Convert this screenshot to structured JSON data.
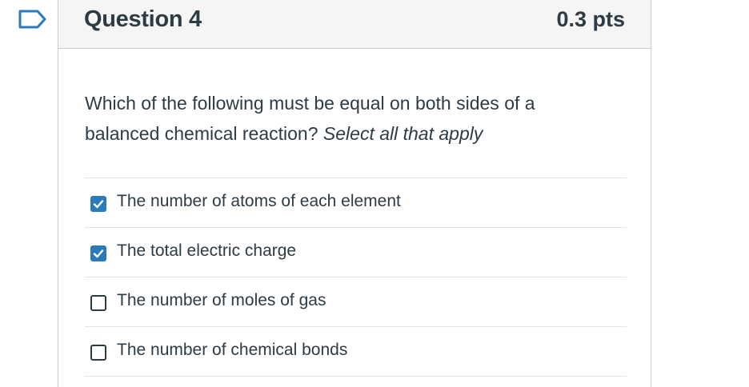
{
  "question": {
    "title": "Question 4",
    "points": "0.3 pts",
    "text_plain": "Which of the following must be equal on both sides of a balanced chemical reaction?",
    "text_italic": "Select all that apply",
    "flag_icon": "flag-outline-icon"
  },
  "answers": [
    {
      "label": "The number of atoms of each element",
      "checked": true
    },
    {
      "label": "The total electric charge",
      "checked": true
    },
    {
      "label": "The number of moles of gas",
      "checked": false
    },
    {
      "label": "The number of chemical bonds",
      "checked": false
    }
  ],
  "colors": {
    "accent": "#2b7abc",
    "text": "#2d3b45",
    "header_bg": "#f5f5f5",
    "border": "#c7cdd1"
  }
}
